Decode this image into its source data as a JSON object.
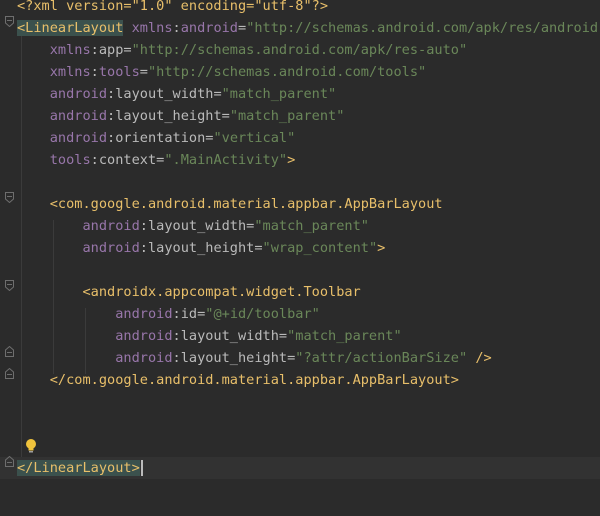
{
  "editor": {
    "file_type": "xml",
    "lines": [
      {
        "parts": [
          [
            "pi",
            "<?xml version=\"1.0\" encoding=\"utf-8\"?>"
          ]
        ]
      },
      {
        "parts": [
          [
            "tag-hl",
            "<LinearLayout"
          ],
          [
            "attr",
            " "
          ],
          [
            "ns",
            "xmlns"
          ],
          [
            "attr",
            ":"
          ],
          [
            "ns",
            "android"
          ],
          [
            "attr",
            "="
          ],
          [
            "val",
            "\"http://schemas.android.com/apk/res/android\""
          ]
        ]
      },
      {
        "parts": [
          [
            "attr",
            "    "
          ],
          [
            "ns",
            "xmlns"
          ],
          [
            "attr",
            ":app="
          ],
          [
            "val",
            "\"http://schemas.android.com/apk/res-auto\""
          ]
        ]
      },
      {
        "parts": [
          [
            "attr",
            "    "
          ],
          [
            "ns",
            "xmlns"
          ],
          [
            "attr",
            ":"
          ],
          [
            "ns",
            "tools"
          ],
          [
            "attr",
            "="
          ],
          [
            "val",
            "\"http://schemas.android.com/tools\""
          ]
        ]
      },
      {
        "parts": [
          [
            "attr",
            "    "
          ],
          [
            "ns",
            "android"
          ],
          [
            "attr",
            ":layout_width="
          ],
          [
            "val",
            "\"match_parent\""
          ]
        ]
      },
      {
        "parts": [
          [
            "attr",
            "    "
          ],
          [
            "ns",
            "android"
          ],
          [
            "attr",
            ":layout_height="
          ],
          [
            "val",
            "\"match_parent\""
          ]
        ]
      },
      {
        "parts": [
          [
            "attr",
            "    "
          ],
          [
            "ns",
            "android"
          ],
          [
            "attr",
            ":orientation="
          ],
          [
            "val",
            "\"vertical\""
          ]
        ]
      },
      {
        "parts": [
          [
            "attr",
            "    "
          ],
          [
            "ns",
            "tools"
          ],
          [
            "attr",
            ":context="
          ],
          [
            "val",
            "\".MainActivity\""
          ],
          [
            "tag",
            ">"
          ]
        ]
      },
      {
        "parts": []
      },
      {
        "parts": [
          [
            "attr",
            "    "
          ],
          [
            "tag",
            "<com.google.android.material.appbar.AppBarLayout"
          ]
        ]
      },
      {
        "parts": [
          [
            "attr",
            "        "
          ],
          [
            "ns",
            "android"
          ],
          [
            "attr",
            ":layout_width="
          ],
          [
            "val",
            "\"match_parent\""
          ]
        ]
      },
      {
        "parts": [
          [
            "attr",
            "        "
          ],
          [
            "ns",
            "android"
          ],
          [
            "attr",
            ":layout_height="
          ],
          [
            "val",
            "\"wrap_content\""
          ],
          [
            "tag",
            ">"
          ]
        ]
      },
      {
        "parts": []
      },
      {
        "parts": [
          [
            "attr",
            "        "
          ],
          [
            "tag",
            "<androidx.appcompat.widget.Toolbar"
          ]
        ]
      },
      {
        "parts": [
          [
            "attr",
            "            "
          ],
          [
            "ns",
            "android"
          ],
          [
            "attr",
            ":id="
          ],
          [
            "val",
            "\"@+id/toolbar\""
          ]
        ]
      },
      {
        "parts": [
          [
            "attr",
            "            "
          ],
          [
            "ns",
            "android"
          ],
          [
            "attr",
            ":layout_width="
          ],
          [
            "val",
            "\"match_parent\""
          ]
        ]
      },
      {
        "parts": [
          [
            "attr",
            "            "
          ],
          [
            "ns",
            "android"
          ],
          [
            "attr",
            ":layout_height="
          ],
          [
            "val",
            "\"?attr/actionBarSize\""
          ],
          [
            "tag",
            " />"
          ]
        ]
      },
      {
        "parts": [
          [
            "attr",
            "    "
          ],
          [
            "tag",
            "</com.google.android.material.appbar.AppBarLayout>"
          ]
        ]
      },
      {
        "parts": []
      },
      {
        "parts": []
      },
      {
        "parts": []
      },
      {
        "parts": [
          [
            "tag-hl",
            "</LinearLayout"
          ],
          [
            "tag-hl",
            ">"
          ]
        ]
      }
    ]
  }
}
